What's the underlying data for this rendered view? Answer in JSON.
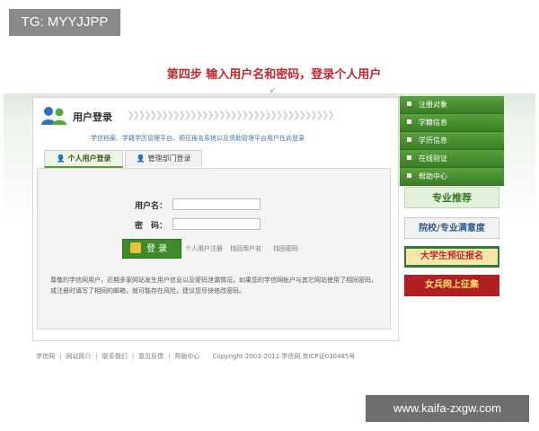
{
  "overlay": {
    "tg_label": "TG: MYYJJPP",
    "watermark": "www.kaifa-zxgw.com"
  },
  "instruction": {
    "step_text": "第四步  输入用户名和密码，登录个人用户",
    "cursor_mark": "↙"
  },
  "login": {
    "title": "用户登录",
    "chevrons": "❯❯❯❯❯❯❯❯❯❯❯❯❯❯❯❯❯❯❯❯❯❯❯❯❯❯❯❯❯❯❯❯❯❯❯❯",
    "description": "学信档案、学籍学历管理平台、预征报名系统以及资助管理平台用户在此登录",
    "tabs": [
      {
        "label": "个人用户登录",
        "icon": "person-icon"
      },
      {
        "label": "管理部门登录",
        "icon": "admin-icon"
      }
    ],
    "username_label": "用户名：",
    "password_label": "密　码：",
    "username_value": "",
    "password_value": "",
    "login_button": "登 录",
    "register_link": "个人用户注册",
    "find_user_link": "找回用户名",
    "find_password_link": "找回密码",
    "notice": "尊敬的学信网用户，近期多家网站发生用户信息以及密码泄漏情况，如果您的学信网帐户与其它网站使用了相同密码，或注册时填写了相同的邮箱，就可能存在风险，建议您尽快修改密码。"
  },
  "sidebar": {
    "items": [
      {
        "label": "注册对象"
      },
      {
        "label": "学籍信息"
      },
      {
        "label": "学历信息"
      },
      {
        "label": "在线验证"
      },
      {
        "label": "帮助中心"
      }
    ],
    "banners": [
      {
        "text": "专业推荐",
        "bg": "#e3f0dc",
        "fg": "#2f7a1c"
      },
      {
        "text": "院校/专业满意度",
        "bg": "#f2f2f2",
        "fg": "#2f5a8a"
      },
      {
        "text": "大学生预征报名",
        "bg": "#2f7a3a",
        "fg": "#c0292b"
      },
      {
        "text": "女兵网上征集",
        "bg": "#b01f22",
        "fg": "#ffe36a"
      }
    ]
  },
  "footer": {
    "links": [
      "学信网",
      "网站简介",
      "联系我们",
      "意见反馈",
      "帮助中心"
    ],
    "copyright": "Copyright 2003-2011 学信网 京ICP证030485号"
  },
  "colors": {
    "accent_green": "#3e8a2d",
    "instruction_red": "#c0292b",
    "link_blue": "#4a6fae"
  }
}
